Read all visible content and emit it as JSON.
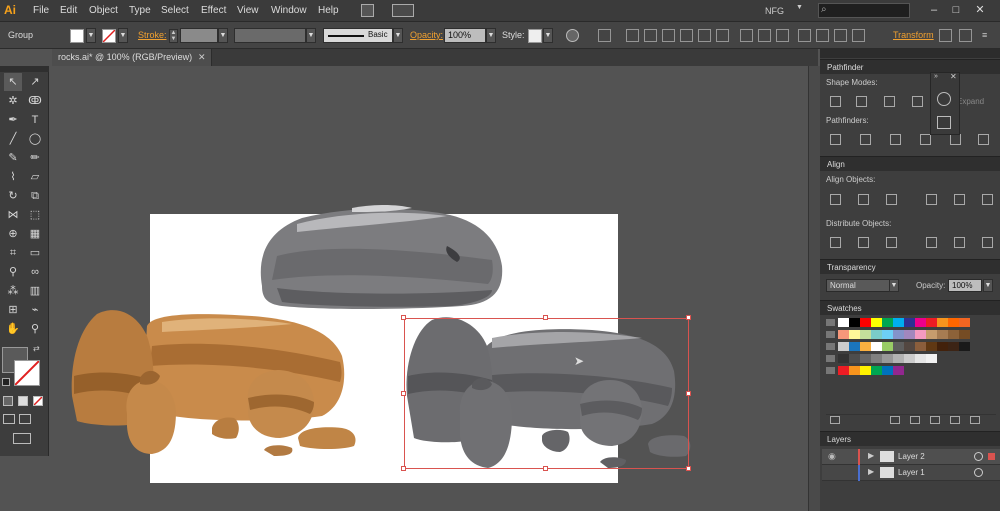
{
  "app": {
    "logo": "Ai",
    "workspace": "NFG"
  },
  "menu": [
    "File",
    "Edit",
    "Object",
    "Type",
    "Select",
    "Effect",
    "View",
    "Window",
    "Help"
  ],
  "window_controls": {
    "minimize": "–",
    "maximize": "□",
    "close": "✕"
  },
  "control_bar": {
    "selection_type": "Group",
    "stroke_label": "Stroke:",
    "brush_label": "Basic",
    "opacity_label": "Opacity:",
    "opacity_value": "100%",
    "style_label": "Style:",
    "transform_label": "Transform"
  },
  "document_tab": {
    "title": "rocks.ai* @ 100% (RGB/Preview)",
    "close": "✕"
  },
  "panels": {
    "pathfinder": {
      "title": "Pathfinder",
      "shape_modes": "Shape Modes:",
      "pathfinders": "Pathfinders:",
      "expand": "Expand"
    },
    "align": {
      "title": "Align",
      "align_objects": "Align Objects:",
      "distribute_objects": "Distribute Objects:"
    },
    "transparency": {
      "title": "Transparency",
      "blend_mode": "Normal",
      "opacity_label": "Opacity:",
      "opacity_value": "100%"
    },
    "swatches": {
      "title": "Swatches"
    },
    "layers": {
      "title": "Layers",
      "items": [
        {
          "name": "Layer 2",
          "color": "#d9534f"
        },
        {
          "name": "Layer 1",
          "color": "#4a6fd0"
        }
      ]
    }
  },
  "swatch_rows": [
    [
      "#ffffff",
      "#000000",
      "#ff0000",
      "#ffff00",
      "#00a650",
      "#00aeef",
      "#2e3192",
      "#ec008c",
      "#ed1c24",
      "#f7941d",
      "#ff6600",
      "#f26522"
    ],
    [
      "#f7977a",
      "#fff799",
      "#c4df9b",
      "#7accc8",
      "#6dcff6",
      "#8393ca",
      "#a187be",
      "#f49ac1",
      "#c69c6d",
      "#a67c52",
      "#8c6239",
      "#754c24"
    ],
    [
      "#cccccc",
      "#1b75bc",
      "#fbb040",
      "#ffffff",
      "#99cc66",
      "#5e5e5e",
      "#534741",
      "#8b5e3c",
      "#603813",
      "#42210b",
      "#3c2415",
      "#1a1a1a"
    ],
    [
      "#333333",
      "#4d4d4d",
      "#666666",
      "#808080",
      "#999999",
      "#b3b3b3",
      "#cccccc",
      "#e6e6e6",
      "#f2f2f2"
    ],
    [
      "#ed1c24",
      "#f7941d",
      "#fff200",
      "#00a651",
      "#0072bc",
      "#92278f"
    ]
  ]
}
